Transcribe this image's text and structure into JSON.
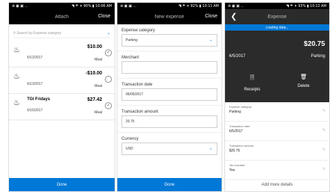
{
  "screen1": {
    "status": {
      "left": "⊕ ▣ ▣ ...",
      "right": "◥ ☂ ✦ 90% ▮ 10:06 AM"
    },
    "title": "Attach",
    "close": "Close",
    "search_placeholder": "Search by Expense category",
    "expenses": [
      {
        "merchant": "",
        "amount": "$10.00",
        "date": "6/12/2017",
        "category": "Meal",
        "checked": true
      },
      {
        "merchant": "",
        "amount": "-$10.00",
        "date": "6/13/2017",
        "category": "Meal",
        "checked": false
      },
      {
        "merchant": "TGI Fridays",
        "amount": "$27.42",
        "date": "6/15/2017",
        "category": "Meal",
        "checked": true
      }
    ],
    "done": "Done"
  },
  "screen2": {
    "status": {
      "left": "⊕ ▣ ▣ ...",
      "right": "◥ ☂ ✦ 92% ▮ 10:11 AM"
    },
    "title": "New expense",
    "close": "Close",
    "fields": {
      "category": {
        "label": "Expense category",
        "value": "Parking"
      },
      "merchant": {
        "label": "Merchant",
        "value": ""
      },
      "date": {
        "label": "Transaction date",
        "value": "06/05/2017"
      },
      "amount": {
        "label": "Transaction amount",
        "value": "20.75"
      },
      "currency": {
        "label": "Currency",
        "value": "USD"
      }
    },
    "done": "Done"
  },
  "screen3": {
    "status": {
      "left": "⊕ ▣ ▣ ...",
      "right": "◥ ☂ ✦ 93% ▮ 10:12 AM"
    },
    "back": "❮",
    "title": "Expense",
    "loading": "Loading data...",
    "amount": "$20.75",
    "date": "6/5/2017",
    "category": "Parking",
    "receipts": "Receipts",
    "delete": "Delete",
    "details": [
      {
        "label": "Expense category",
        "value": "Parking"
      },
      {
        "label": "Transaction date",
        "value": "6/5/2017"
      },
      {
        "label": "Transaction amount",
        "value": "$20.75"
      },
      {
        "label": "Tax included",
        "value": "Yes"
      }
    ],
    "add_more": "Add more details"
  },
  "icons": {
    "meal": "meal-icon",
    "receipt": "receipt-icon",
    "delete": "trash-icon",
    "edit": "pencil-icon",
    "chevron": "chevron-down-icon"
  },
  "colors": {
    "accent": "#0078d7",
    "topbar": "#000000",
    "hero": "#2b2b2b"
  }
}
